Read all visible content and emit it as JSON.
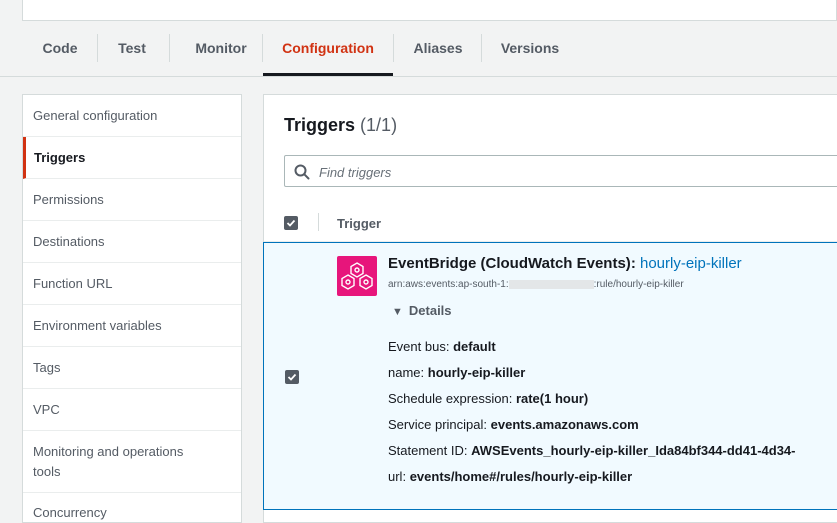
{
  "tabs": [
    {
      "label": "Code"
    },
    {
      "label": "Test"
    },
    {
      "label": "Monitor"
    },
    {
      "label": "Configuration"
    },
    {
      "label": "Aliases"
    },
    {
      "label": "Versions"
    }
  ],
  "active_tab": "Configuration",
  "sidebar": {
    "items": [
      {
        "label": "General configuration"
      },
      {
        "label": "Triggers"
      },
      {
        "label": "Permissions"
      },
      {
        "label": "Destinations"
      },
      {
        "label": "Function URL"
      },
      {
        "label": "Environment variables"
      },
      {
        "label": "Tags"
      },
      {
        "label": "VPC"
      },
      {
        "label": "Monitoring and operations tools"
      },
      {
        "label": "Concurrency"
      }
    ],
    "active": "Triggers"
  },
  "panel": {
    "title": "Triggers",
    "count": "(1/1)",
    "search_placeholder": "Find triggers",
    "column_header": "Trigger"
  },
  "trigger": {
    "source": "EventBridge (CloudWatch Events)",
    "separator": ":",
    "name_link": "hourly-eip-killer",
    "arn_prefix": "arn:aws:events:ap-south-1:",
    "arn_suffix": ":rule/hourly-eip-killer",
    "details_label": "Details",
    "details": [
      {
        "key": "Event bus:",
        "value": "default"
      },
      {
        "key": "name:",
        "value": "hourly-eip-killer"
      },
      {
        "key": "Schedule expression:",
        "value": "rate(1 hour)"
      },
      {
        "key": "Service principal:",
        "value": "events.amazonaws.com"
      },
      {
        "key": "Statement ID:",
        "value": "AWSEvents_hourly-eip-killer_Ida84bf344-dd41-4d34-"
      },
      {
        "key": "url:",
        "value": "events/home#/rules/hourly-eip-killer"
      }
    ],
    "checked": true
  },
  "colors": {
    "accent": "#d13212",
    "link": "#0073bb",
    "selected_bg": "#f1faff",
    "eventbridge": "#e7157b"
  }
}
